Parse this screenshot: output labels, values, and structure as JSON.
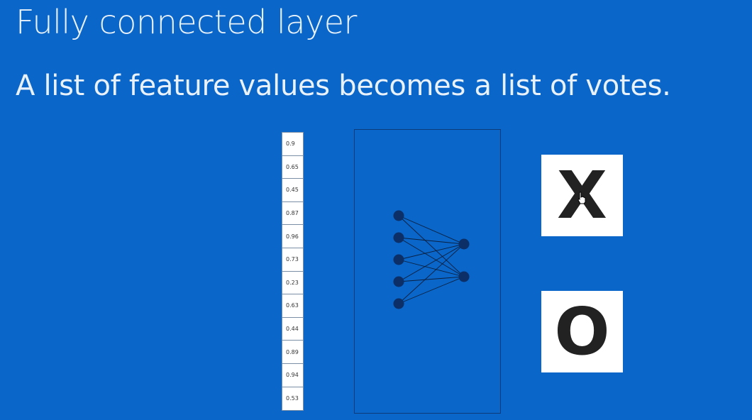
{
  "slide": {
    "title": "Fully connected layer",
    "subtitle": "A list of feature values becomes a list of votes."
  },
  "features": [
    "0.9",
    "0.65",
    "0.45",
    "0.87",
    "0.96",
    "0.73",
    "0.23",
    "0.63",
    "0.44",
    "0.89",
    "0.94",
    "0.53"
  ],
  "network": {
    "input_nodes": 5,
    "output_nodes": 2
  },
  "votes": {
    "x_label": "X",
    "o_label": "O"
  },
  "colors": {
    "background": "#0a66c8",
    "node": "#0b2f66",
    "text": "#e9f1fb"
  }
}
